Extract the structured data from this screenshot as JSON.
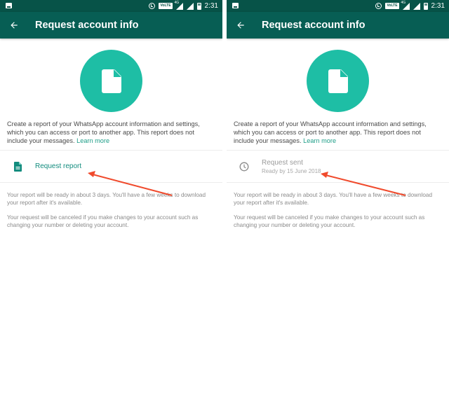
{
  "status_bar": {
    "network_badge": "VoLTE",
    "signal_label": "4G",
    "time": "2:31"
  },
  "toolbar": {
    "title": "Request account info",
    "back_icon": "arrow-left-icon"
  },
  "hero": {
    "icon": "document-icon",
    "circle_color": "#1ebea5"
  },
  "description": {
    "text": "Create a report of your WhatsApp account information and settings, which you can access or port to another app. This report does not include your messages.",
    "link": "Learn more"
  },
  "panels": [
    {
      "state": "before",
      "action": {
        "icon": "document-icon",
        "label": "Request report"
      }
    },
    {
      "state": "after",
      "action": {
        "icon": "clock-icon",
        "label": "Request sent",
        "sublabel": "Ready by 15 June 2018"
      }
    }
  ],
  "info": {
    "paragraph1": "Your report will be ready in about 3 days. You'll have a few weeks to download your report after it's available.",
    "paragraph2": "Your request will be canceled if you make changes to your account such as changing your number or deleting your account."
  },
  "colors": {
    "status_bar": "#075348",
    "toolbar": "#075e54",
    "accent": "#128c7e",
    "annotation_arrow": "#f04a2c"
  }
}
